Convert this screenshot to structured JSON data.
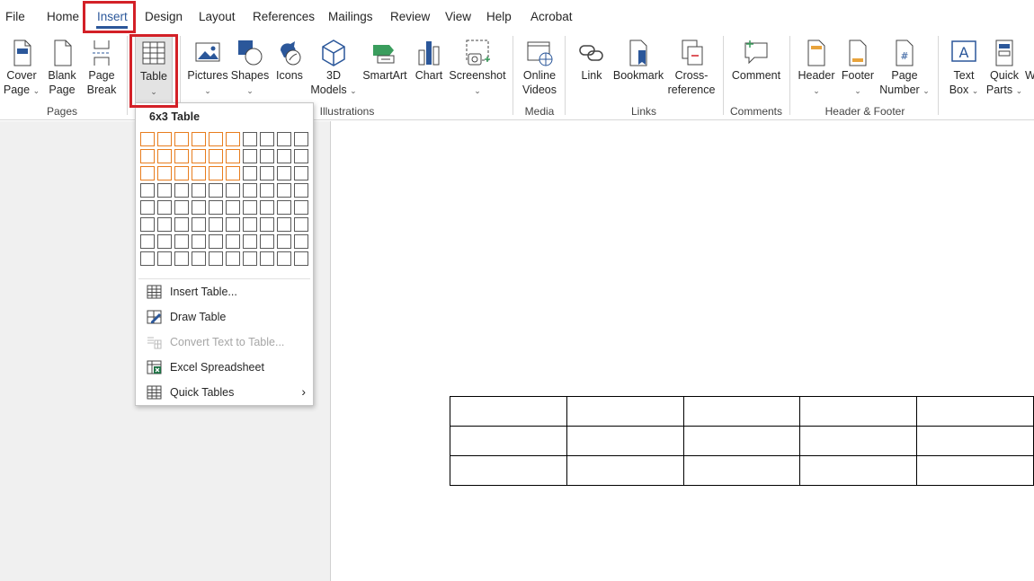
{
  "menu_tabs": [
    "File",
    "Home",
    "Insert",
    "Design",
    "Layout",
    "References",
    "Mailings",
    "Review",
    "View",
    "Help",
    "Acrobat"
  ],
  "active_tab": "Insert",
  "ribbon": {
    "pages": {
      "name": "Pages",
      "cover": {
        "l1": "Cover",
        "l2": "Page"
      },
      "blank": {
        "l1": "Blank",
        "l2": "Page"
      },
      "break": {
        "l1": "Page",
        "l2": "Break"
      }
    },
    "tables": {
      "table": {
        "l1": "Table"
      }
    },
    "illustrations": {
      "name": "Illustrations",
      "pictures": {
        "l1": "Pictures"
      },
      "shapes": {
        "l1": "Shapes"
      },
      "icons": {
        "l1": "Icons"
      },
      "models": {
        "l1": "3D",
        "l2": "Models"
      },
      "smartart": {
        "l1": "SmartArt"
      },
      "chart": {
        "l1": "Chart"
      },
      "screenshot": {
        "l1": "Screenshot"
      }
    },
    "media": {
      "name": "Media",
      "online": {
        "l1": "Online",
        "l2": "Videos"
      }
    },
    "links": {
      "name": "Links",
      "link": {
        "l1": "Link"
      },
      "bookmark": {
        "l1": "Bookmark"
      },
      "xref": {
        "l1": "Cross-",
        "l2": "reference"
      }
    },
    "comments": {
      "name": "Comments",
      "comment": {
        "l1": "Comment"
      }
    },
    "headerfooter": {
      "name": "Header & Footer",
      "header": {
        "l1": "Header"
      },
      "footer": {
        "l1": "Footer"
      },
      "pagenum": {
        "l1": "Page",
        "l2": "Number"
      }
    },
    "text": {
      "textbox": {
        "l1": "Text",
        "l2": "Box"
      },
      "quickparts": {
        "l1": "Quick",
        "l2": "Parts"
      },
      "more": {
        "l1": "W"
      }
    }
  },
  "table_dropdown": {
    "grid_title": "6x3 Table",
    "grid_cols": 10,
    "grid_rows": 8,
    "selected_cols": 6,
    "selected_rows": 3,
    "items": [
      {
        "label": "Insert Table...",
        "icon": "table-grid-icon",
        "enabled": true
      },
      {
        "label": "Draw Table",
        "icon": "pencil-table-icon",
        "enabled": true
      },
      {
        "label": "Convert Text to Table...",
        "icon": "convert-text-icon",
        "enabled": false
      },
      {
        "label": "Excel Spreadsheet",
        "icon": "excel-icon",
        "enabled": true
      },
      {
        "label": "Quick Tables",
        "icon": "table-grid-icon",
        "enabled": true,
        "submenu": true
      }
    ]
  },
  "document_table": {
    "cols": 5,
    "rows": 3
  },
  "accent_color": "#2b579a",
  "highlight_color": "#d32027",
  "grid_highlight_color": "#e87d1e"
}
